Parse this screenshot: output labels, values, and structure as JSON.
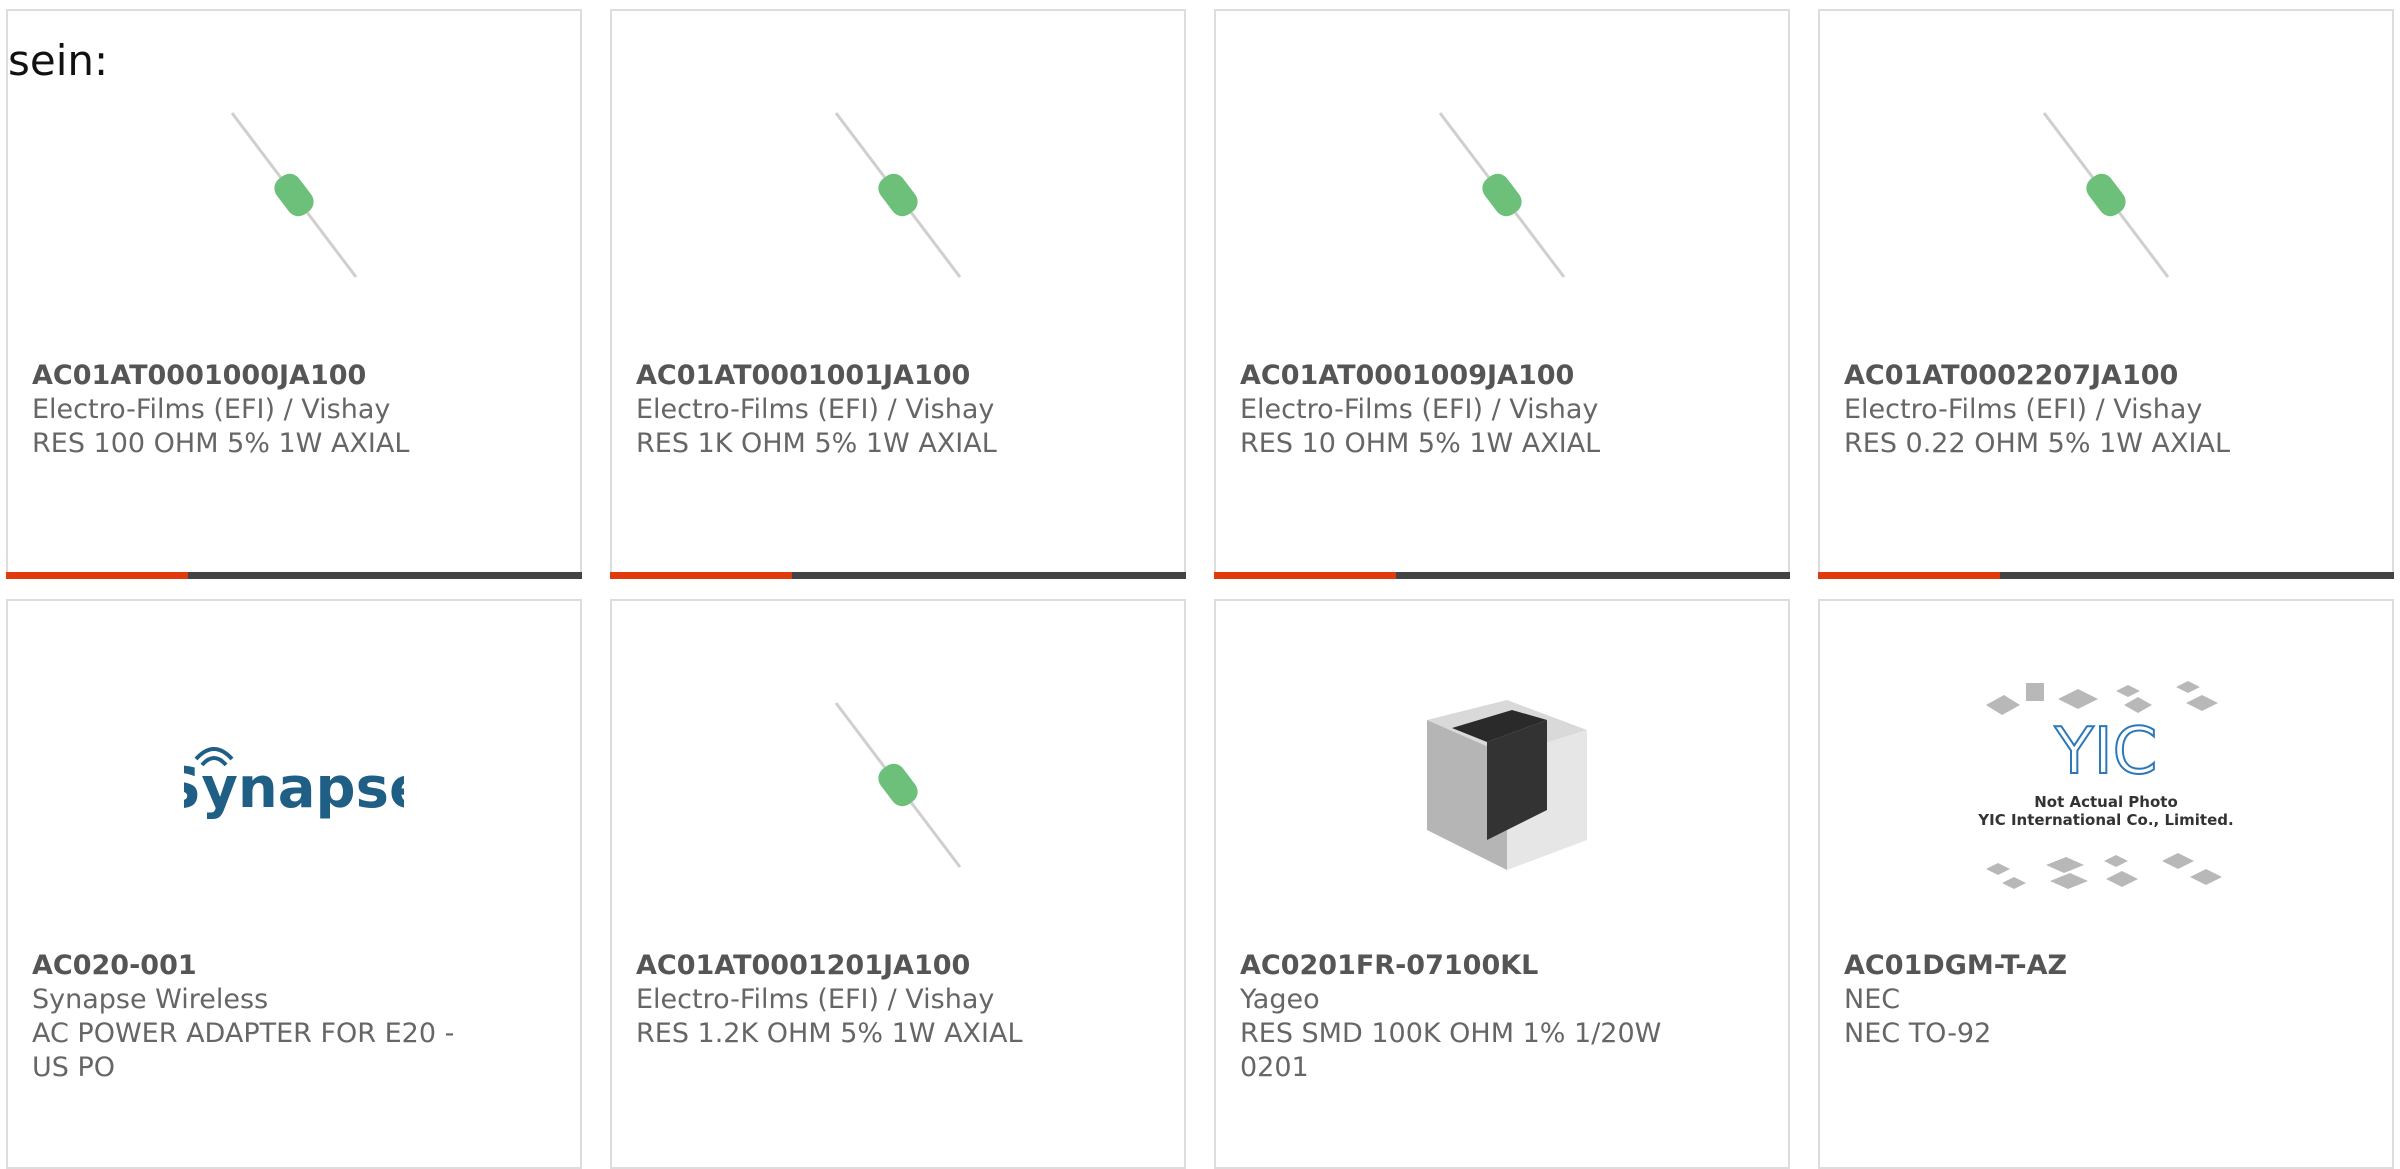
{
  "lead_text": "sein:",
  "products": [
    {
      "part": "AC01AT0001000JA100",
      "mfr": "Electro-Films (EFI) / Vishay",
      "desc": "RES 100 OHM 5% 1W AXIAL",
      "image": "axial-resistor-icon"
    },
    {
      "part": "AC01AT0001001JA100",
      "mfr": "Electro-Films (EFI) / Vishay",
      "desc": "RES 1K OHM 5% 1W AXIAL",
      "image": "axial-resistor-icon"
    },
    {
      "part": "AC01AT0001009JA100",
      "mfr": "Electro-Films (EFI) / Vishay",
      "desc": "RES 10 OHM 5% 1W AXIAL",
      "image": "axial-resistor-icon"
    },
    {
      "part": "AC01AT0002207JA100",
      "mfr": "Electro-Films (EFI) / Vishay",
      "desc": "RES 0.22 OHM 5% 1W AXIAL",
      "image": "axial-resistor-icon"
    },
    {
      "part": "AC020-001",
      "mfr": "Synapse Wireless",
      "desc": "AC POWER ADAPTER FOR E20 - US PO",
      "image": "synapse-logo",
      "logo_text": "Synapse"
    },
    {
      "part": "AC01AT0001201JA100",
      "mfr": "Electro-Films (EFI) / Vishay",
      "desc": "RES 1.2K OHM 5% 1W AXIAL",
      "image": "axial-resistor-icon"
    },
    {
      "part": "AC0201FR-07100KL",
      "mfr": "Yageo",
      "desc": "RES SMD 100K OHM 1% 1/20W 0201",
      "image": "smd-chip-resistor-icon"
    },
    {
      "part": "AC01DGM-T-AZ",
      "mfr": "NEC",
      "desc": "NEC TO-92",
      "image": "yic-placeholder-photo",
      "placeholder_logo": "YIC",
      "placeholder_line1": "Not Actual Photo",
      "placeholder_line2": "YIC International Co., Limited."
    }
  ],
  "colors": {
    "accent_bar": "#e03a0d",
    "bar_dark": "#444444",
    "resistor_body": "#6cc07a",
    "synapse_blue": "#1f5f86"
  }
}
